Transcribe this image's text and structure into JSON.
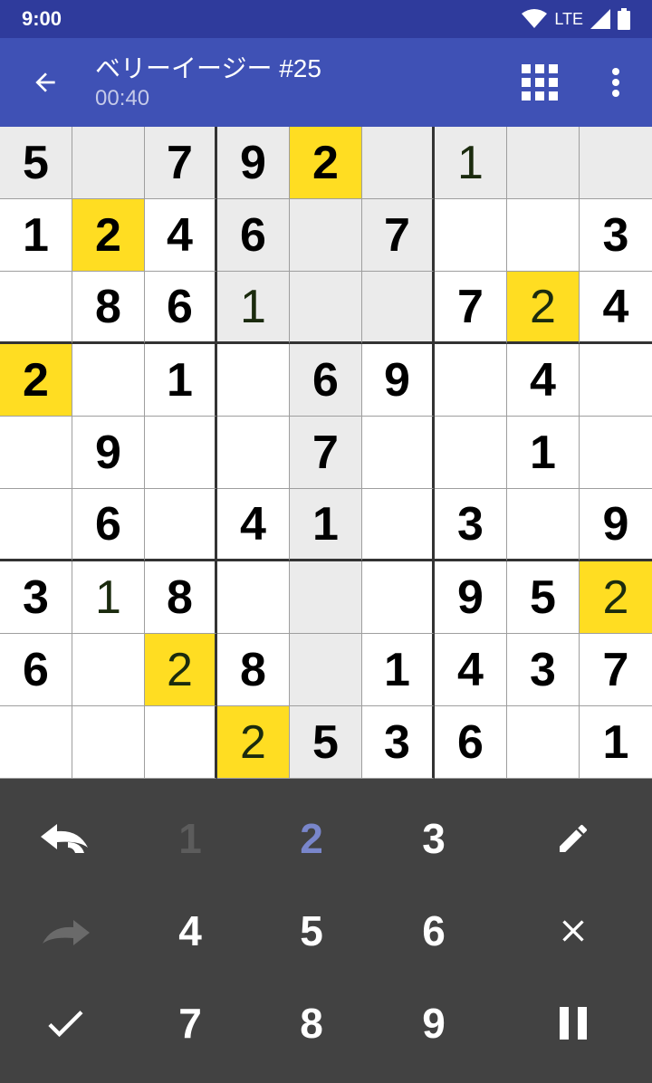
{
  "status": {
    "time": "9:00",
    "network": "LTE"
  },
  "header": {
    "title": "ベリーイージー #25",
    "timer": "00:40"
  },
  "board": [
    [
      {
        "v": "5",
        "t": "g"
      },
      {
        "v": "",
        "t": ""
      },
      {
        "v": "7",
        "t": "g"
      },
      {
        "v": "9",
        "t": "g"
      },
      {
        "v": "2",
        "t": "g"
      },
      {
        "v": "",
        "t": ""
      },
      {
        "v": "1",
        "t": "u"
      },
      {
        "v": "",
        "t": ""
      },
      {
        "v": "",
        "t": ""
      }
    ],
    [
      {
        "v": "1",
        "t": "g"
      },
      {
        "v": "2",
        "t": "g"
      },
      {
        "v": "4",
        "t": "g"
      },
      {
        "v": "6",
        "t": "g"
      },
      {
        "v": "",
        "t": ""
      },
      {
        "v": "7",
        "t": "g"
      },
      {
        "v": "",
        "t": ""
      },
      {
        "v": "",
        "t": ""
      },
      {
        "v": "3",
        "t": "g"
      }
    ],
    [
      {
        "v": "",
        "t": ""
      },
      {
        "v": "8",
        "t": "g"
      },
      {
        "v": "6",
        "t": "g"
      },
      {
        "v": "1",
        "t": "u"
      },
      {
        "v": "",
        "t": ""
      },
      {
        "v": "",
        "t": ""
      },
      {
        "v": "7",
        "t": "g"
      },
      {
        "v": "2",
        "t": "u"
      },
      {
        "v": "4",
        "t": "g"
      }
    ],
    [
      {
        "v": "2",
        "t": "g"
      },
      {
        "v": "",
        "t": ""
      },
      {
        "v": "1",
        "t": "g"
      },
      {
        "v": "",
        "t": ""
      },
      {
        "v": "6",
        "t": "g"
      },
      {
        "v": "9",
        "t": "g"
      },
      {
        "v": "",
        "t": ""
      },
      {
        "v": "4",
        "t": "g"
      },
      {
        "v": "",
        "t": ""
      }
    ],
    [
      {
        "v": "",
        "t": ""
      },
      {
        "v": "9",
        "t": "g"
      },
      {
        "v": "",
        "t": ""
      },
      {
        "v": "",
        "t": ""
      },
      {
        "v": "7",
        "t": "g"
      },
      {
        "v": "",
        "t": ""
      },
      {
        "v": "",
        "t": ""
      },
      {
        "v": "1",
        "t": "g"
      },
      {
        "v": "",
        "t": ""
      }
    ],
    [
      {
        "v": "",
        "t": ""
      },
      {
        "v": "6",
        "t": "g"
      },
      {
        "v": "",
        "t": ""
      },
      {
        "v": "4",
        "t": "g"
      },
      {
        "v": "1",
        "t": "g"
      },
      {
        "v": "",
        "t": ""
      },
      {
        "v": "3",
        "t": "g"
      },
      {
        "v": "",
        "t": ""
      },
      {
        "v": "9",
        "t": "g"
      }
    ],
    [
      {
        "v": "3",
        "t": "g"
      },
      {
        "v": "1",
        "t": "u"
      },
      {
        "v": "8",
        "t": "g"
      },
      {
        "v": "",
        "t": ""
      },
      {
        "v": "",
        "t": ""
      },
      {
        "v": "",
        "t": ""
      },
      {
        "v": "9",
        "t": "g"
      },
      {
        "v": "5",
        "t": "g"
      },
      {
        "v": "2",
        "t": "u"
      }
    ],
    [
      {
        "v": "6",
        "t": "g"
      },
      {
        "v": "",
        "t": ""
      },
      {
        "v": "2",
        "t": "u"
      },
      {
        "v": "8",
        "t": "g"
      },
      {
        "v": "",
        "t": ""
      },
      {
        "v": "1",
        "t": "g"
      },
      {
        "v": "4",
        "t": "g"
      },
      {
        "v": "3",
        "t": "g"
      },
      {
        "v": "7",
        "t": "g"
      }
    ],
    [
      {
        "v": "",
        "t": ""
      },
      {
        "v": "",
        "t": ""
      },
      {
        "v": "",
        "t": ""
      },
      {
        "v": "2",
        "t": "u"
      },
      {
        "v": "5",
        "t": "g"
      },
      {
        "v": "3",
        "t": "g"
      },
      {
        "v": "6",
        "t": "g"
      },
      {
        "v": "",
        "t": ""
      },
      {
        "v": "1",
        "t": "g"
      }
    ]
  ],
  "selected": {
    "row": 0,
    "col": 4
  },
  "highlight_digit": "2",
  "keypad": {
    "digits": [
      "1",
      "2",
      "3",
      "4",
      "5",
      "6",
      "7",
      "8",
      "9"
    ],
    "disabled_digits": [
      "1"
    ],
    "active_digit": "2",
    "icons": {
      "undo": "undo-icon",
      "redo": "redo-icon",
      "pencil": "pencil-icon",
      "erase": "close-icon",
      "check": "check-icon",
      "pause": "pause-icon"
    }
  },
  "colors": {
    "primary": "#3f51b5",
    "primary_dark": "#2f3b9c",
    "highlight": "#ffdd22",
    "shade": "#ebebeb",
    "keypad_bg": "#424242",
    "active_digit": "#7986cb"
  }
}
